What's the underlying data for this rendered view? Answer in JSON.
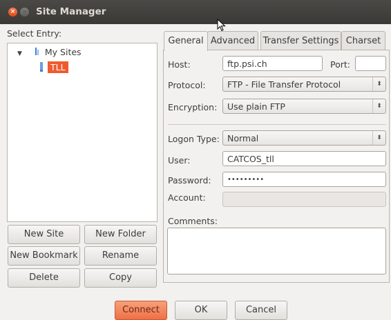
{
  "window": {
    "title": "Site Manager",
    "close_glyph": "×",
    "min_glyph": "–"
  },
  "left": {
    "select_entry_label": "Select Entry:",
    "tree": [
      {
        "label": "My Sites",
        "icon": "folder-icon"
      },
      {
        "label": "TLL",
        "icon": "server-icon"
      }
    ],
    "buttons": {
      "new_site": "New Site",
      "new_folder": "New Folder",
      "new_bookmark": "New Bookmark",
      "rename": "Rename",
      "delete": "Delete",
      "copy": "Copy"
    }
  },
  "tabs": [
    "General",
    "Advanced",
    "Transfer Settings",
    "Charset"
  ],
  "general": {
    "host_label": "Host:",
    "host_value": "ftp.psi.ch",
    "port_label": "Port:",
    "port_value": "",
    "protocol_label": "Protocol:",
    "protocol_value": "FTP - File Transfer Protocol",
    "encryption_label": "Encryption:",
    "encryption_value": "Use plain FTP",
    "logon_type_label": "Logon Type:",
    "logon_type_value": "Normal",
    "user_label": "User:",
    "user_value": "CATCOS_tll",
    "password_label": "Password:",
    "password_value": "•••••••••",
    "account_label": "Account:",
    "account_value": "",
    "comments_label": "Comments:",
    "comments_value": ""
  },
  "footer": {
    "connect": "Connect",
    "ok": "OK",
    "cancel": "Cancel"
  },
  "colors": {
    "accent": "#ef5b2f",
    "titlebar": "#3c3b37"
  }
}
